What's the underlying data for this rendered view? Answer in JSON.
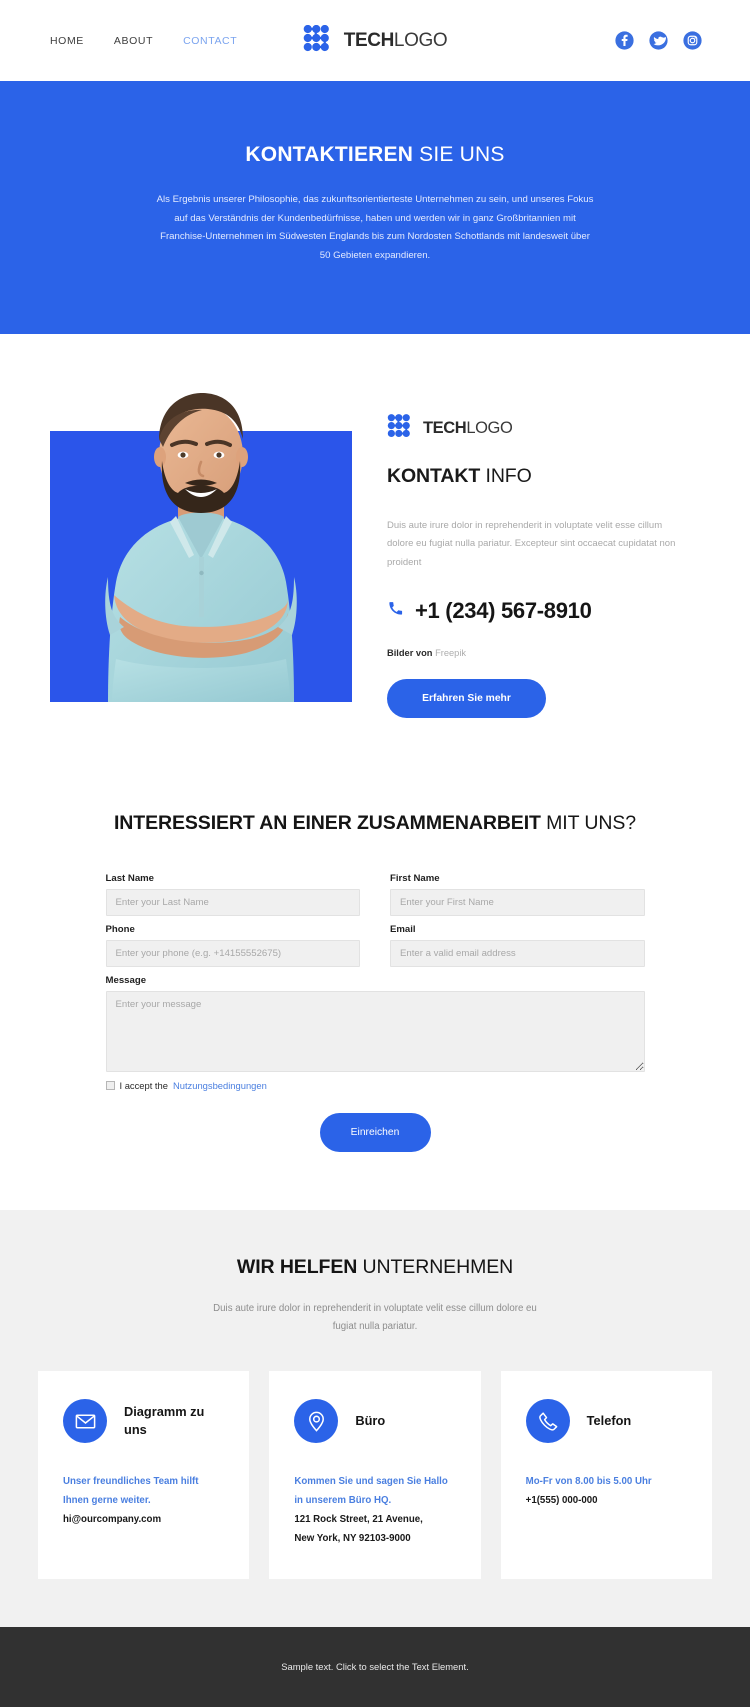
{
  "header": {
    "nav": [
      {
        "label": "HOME",
        "active": false
      },
      {
        "label": "ABOUT",
        "active": false
      },
      {
        "label": "CONTACT",
        "active": true
      }
    ],
    "logo": {
      "bold": "TECH",
      "light": "LOGO",
      "icon": "tech-dots-logo-icon"
    },
    "social": [
      {
        "name": "facebook-icon",
        "label": "Facebook"
      },
      {
        "name": "twitter-icon",
        "label": "Twitter"
      },
      {
        "name": "instagram-icon",
        "label": "Instagram"
      }
    ]
  },
  "hero": {
    "title_bold": "KONTAKTIEREN",
    "title_light": " SIE UNS",
    "paragraph": "Als Ergebnis unserer Philosophie, das zukunftsorientierteste Unternehmen zu sein, und unseres Fokus auf das Verständnis der Kundenbedürfnisse, haben und werden wir in ganz Großbritannien mit Franchise-Unternehmen im Südwesten Englands bis zum Nordosten Schottlands mit landesweit über 50 Gebieten expandieren.",
    "background_color": "#2b63e8"
  },
  "info": {
    "image_alt": "smiling-bearded-man-with-crossed-arms",
    "image_backdrop_color": "#2b55ea",
    "logo": {
      "bold": "TECH",
      "light": "LOGO"
    },
    "title_bold": "KONTAKT",
    "title_light": " INFO",
    "description": "Duis aute irure dolor in reprehenderit in voluptate velit esse cillum dolore eu fugiat nulla pariatur. Excepteur sint occaecat cupidatat non proident",
    "phone": "+1 (234) 567-8910",
    "phone_icon": "phone-icon",
    "credit_label": "Bilder von",
    "credit_source": "Freepik",
    "cta_label": "Erfahren Sie mehr"
  },
  "form": {
    "title_bold": "INTERESSIERT AN EINER ZUSAMMENARBEIT",
    "title_light": " MIT UNS?",
    "fields": {
      "last_name": {
        "label": "Last Name",
        "placeholder": "Enter your Last Name",
        "value": ""
      },
      "first_name": {
        "label": "First Name",
        "placeholder": "Enter your First Name",
        "value": ""
      },
      "phone": {
        "label": "Phone",
        "placeholder": "Enter your phone (e.g. +14155552675)",
        "value": ""
      },
      "email": {
        "label": "Email",
        "placeholder": "Enter a valid email address",
        "value": ""
      },
      "message": {
        "label": "Message",
        "placeholder": "Enter your message",
        "value": ""
      }
    },
    "accept_text": "I accept the",
    "accept_link": "Nutzungsbedingungen",
    "accept_checked": false,
    "submit_label": "Einreichen"
  },
  "help": {
    "title_bold": "WIR HELFEN",
    "title_light": " UNTERNEHMEN",
    "subtitle": "Duis aute irure dolor in reprehenderit in voluptate velit esse cillum dolore eu fugiat nulla pariatur.",
    "cards": [
      {
        "icon": "envelope-icon",
        "title": "Diagramm zu uns",
        "highlight": "Unser freundliches Team hilft Ihnen gerne weiter.",
        "detail_1": "hi@ourcompany.com",
        "detail_2": ""
      },
      {
        "icon": "map-pin-icon",
        "title": "Büro",
        "highlight": "Kommen Sie und sagen Sie Hallo in unserem Büro HQ.",
        "detail_1": "121 Rock Street, 21 Avenue,",
        "detail_2": "New York, NY 92103-9000"
      },
      {
        "icon": "phone-handset-icon",
        "title": "Telefon",
        "highlight": "Mo-Fr von 8.00 bis 5.00 Uhr",
        "detail_1": "+1(555) 000-000",
        "detail_2": ""
      }
    ]
  },
  "footer": {
    "text": "Sample text. Click to select the Text Element.",
    "background_color": "#313131"
  },
  "theme": {
    "accent": "#2b63e8",
    "accent_light": "#7ba4ef",
    "link": "#4a7fe0",
    "muted": "#a9a9a9",
    "dark": "#151515",
    "section_gray": "#f1f1f1",
    "field_gray": "#f0f0f0"
  }
}
